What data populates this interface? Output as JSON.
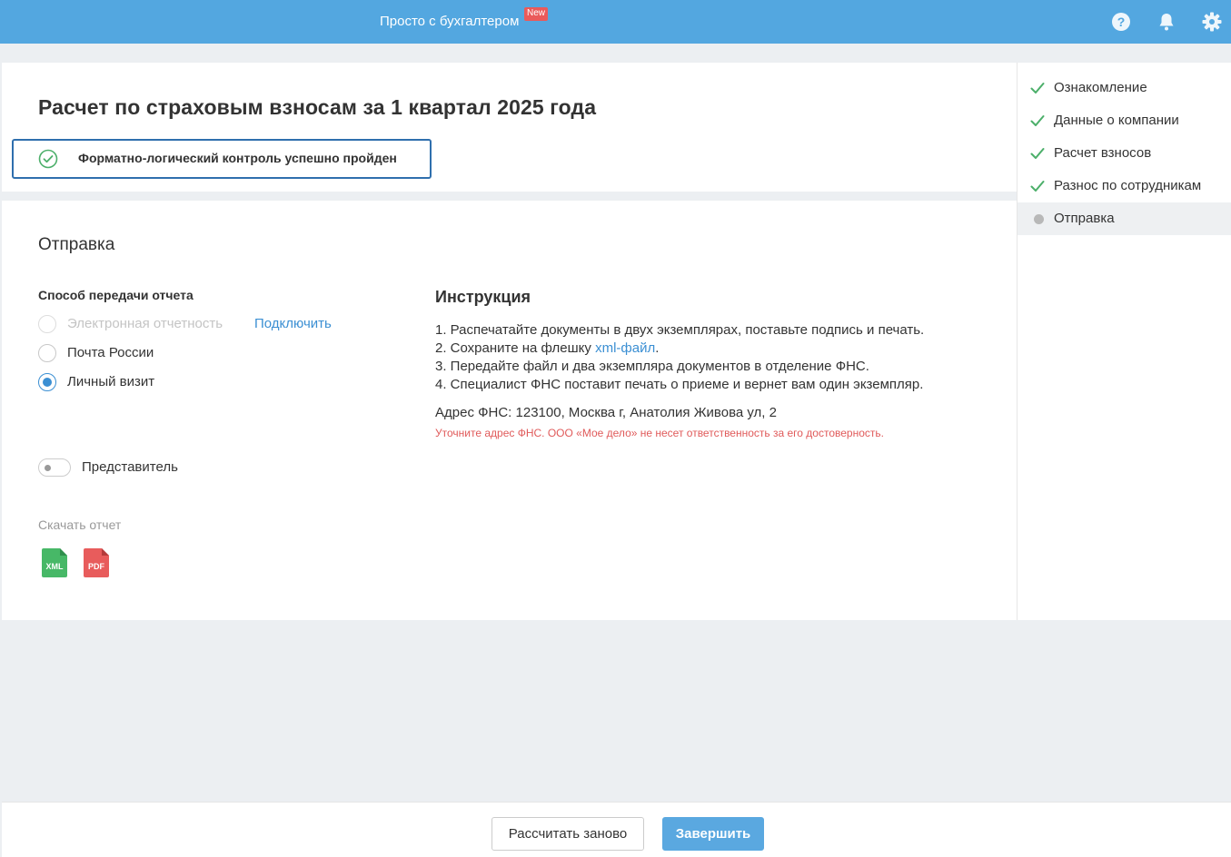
{
  "topbar": {
    "promo_label": "Просто с бухгалтером",
    "promo_badge": "New",
    "icons": [
      "help-icon",
      "bell-icon",
      "gear-icon"
    ]
  },
  "header": {
    "title": "Расчет по страховым взносам за 1 квартал 2025 года",
    "control_status": "Форматно-логический контроль успешно пройден"
  },
  "sending": {
    "section_title": "Отправка",
    "method_label": "Способ передачи отчета",
    "methods": [
      {
        "label": "Электронная отчетность",
        "disabled": true,
        "checked": false
      },
      {
        "label": "Почта России",
        "disabled": false,
        "checked": false
      },
      {
        "label": "Личный визит",
        "disabled": false,
        "checked": true
      }
    ],
    "connect_link": "Подключить",
    "representative_label": "Представитель",
    "representative_on": false,
    "download_label": "Скачать отчет",
    "download_formats": [
      "XML",
      "PDF"
    ]
  },
  "instruction": {
    "title": "Инструкция",
    "steps": [
      "1. Распечатайте документы в двух экземплярах, поставьте подпись и печать.",
      "2. Сохраните на флешку ",
      "3. Передайте файл и два экземпляра документов в отделение ФНС.",
      "4. Специалист ФНС поставит печать о приеме и вернет вам один экземпляр."
    ],
    "xml_link": "xml-файл",
    "xml_link_suffix": ".",
    "fns_address": "Адрес ФНС: 123100, Москва г, Анатолия Живова ул, 2",
    "warning": "Уточните адрес ФНС. ООО «Мое дело» не несет ответственность за его достоверность."
  },
  "sidebar": {
    "steps": [
      {
        "label": "Ознакомление",
        "status": "done"
      },
      {
        "label": "Данные о компании",
        "status": "done"
      },
      {
        "label": "Расчет взносов",
        "status": "done"
      },
      {
        "label": "Разнос по сотрудникам",
        "status": "done"
      },
      {
        "label": "Отправка",
        "status": "current"
      }
    ]
  },
  "footer": {
    "recalc_label": "Рассчитать заново",
    "finish_label": "Завершить"
  },
  "colors": {
    "topbar": "#53a7e0",
    "accent": "#3b8fd3",
    "success": "#4caf6a",
    "warning": "#e05a5a",
    "badge": "#ea5a5a",
    "xml_file": "#47b867",
    "pdf_file": "#e85c5c"
  }
}
